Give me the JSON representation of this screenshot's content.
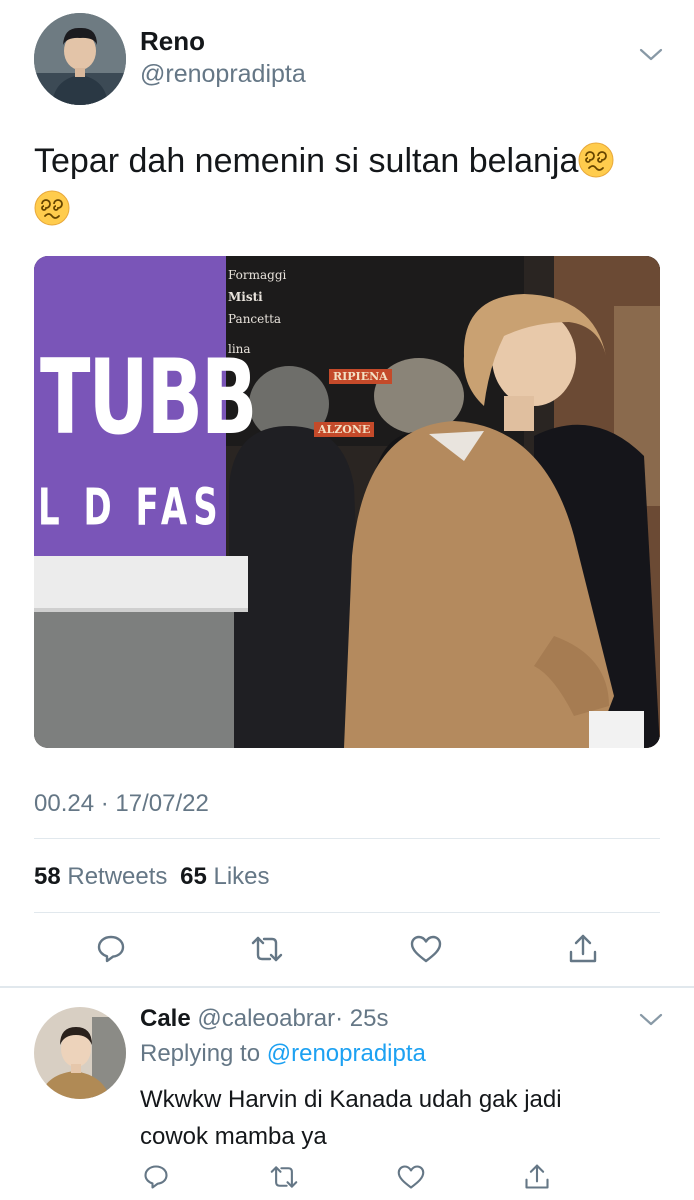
{
  "tweet": {
    "author_name": "Reno",
    "author_handle": "@renopradipta",
    "text": "Tepar dah nemenin si sultan belanja",
    "emoji_names": [
      "woozy-dizzy-face-emoji",
      "woozy-dizzy-face-emoji"
    ],
    "timestamp": "00.24 · 17/07/22",
    "retweets_count": "58",
    "retweets_label": "Retweets",
    "likes_count": "65",
    "likes_label": "Likes",
    "photo_signage": {
      "sign_line_1": "TUBB",
      "sign_line_2": "L D FAS",
      "menu_lines": [
        "Formaggi",
        "Misti",
        "Pancetta",
        "lina",
        "RIPIENA",
        "ALZONE"
      ]
    }
  },
  "actions": {
    "icons": [
      "reply-icon",
      "retweet-icon",
      "like-icon",
      "share-icon"
    ]
  },
  "reply": {
    "author_name": "Cale",
    "author_handle": "@caleoabrar",
    "time": "· 25s",
    "replying_to_label": "Replying to",
    "replying_to_handle": "@renopradipta",
    "text_line_1": "Wkwkw Harvin di Kanada udah gak jadi",
    "text_line_2": "cowok mamba ya"
  },
  "colors": {
    "link": "#1da1f2",
    "muted": "#657786",
    "divider": "#e1e8ed",
    "sign_purple": "#7a55b8"
  }
}
